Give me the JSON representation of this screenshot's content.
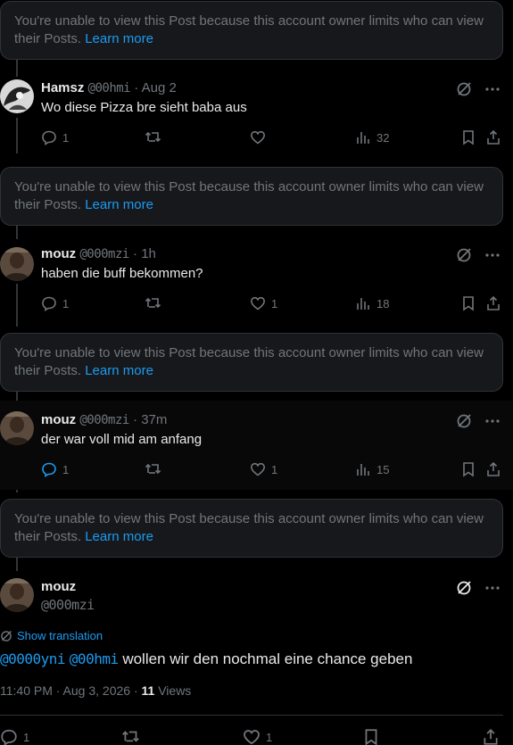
{
  "notice": {
    "text": "You're unable to view this Post because this account owner limits who can view their Posts.",
    "link": "Learn more"
  },
  "replies": [
    {
      "name": "Hamsz",
      "handle": "@00hmi",
      "sep": "·",
      "time": "Aug 2",
      "text": "Wo diese Pizza bre sieht baba aus",
      "replies": "1",
      "likes": "",
      "views": "32"
    },
    {
      "name": "mouz",
      "handle": "@000mzi",
      "sep": "·",
      "time": "1h",
      "text": "haben die buff bekommen?",
      "replies": "1",
      "likes": "1",
      "views": "18"
    },
    {
      "name": "mouz",
      "handle": "@000mzi",
      "sep": "·",
      "time": "37m",
      "text": "der war voll mid am anfang",
      "replies": "1",
      "likes": "1",
      "views": "15"
    }
  ],
  "main": {
    "name": "mouz",
    "handle": "@000mzi",
    "translate": "Show translation",
    "mention1": "@0000yni",
    "mention2": "@00hmi",
    "text": "wollen wir den nochmal eine chance geben",
    "meta": "11:40 PM · Aug 3, 2026 · ",
    "views_count": "11",
    "views_label": "Views",
    "replies": "1",
    "likes": "1"
  },
  "colors": {
    "accent": "#1d9bf0",
    "muted": "#71767b",
    "text": "#e7e9ea",
    "card": "#16181c"
  }
}
